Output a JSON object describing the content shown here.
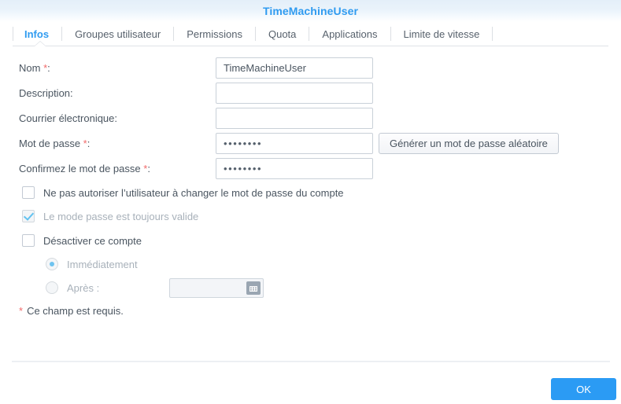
{
  "window": {
    "title": "TimeMachineUser",
    "title_color": "#2f9bf0"
  },
  "tabs": [
    {
      "label": "Infos",
      "active": true
    },
    {
      "label": "Groupes utilisateur",
      "active": false
    },
    {
      "label": "Permissions",
      "active": false
    },
    {
      "label": "Quota",
      "active": false
    },
    {
      "label": "Applications",
      "active": false
    },
    {
      "label": "Limite de vitesse",
      "active": false
    }
  ],
  "form": {
    "name": {
      "label": "Nom",
      "required_mark": "*",
      "colon": ":",
      "value": "TimeMachineUser",
      "placeholder": ""
    },
    "description": {
      "label": "Description:",
      "value": "",
      "placeholder": ""
    },
    "email": {
      "label": "Courrier électronique:",
      "value": "",
      "placeholder": ""
    },
    "password": {
      "label": "Mot de passe",
      "required_mark": "*",
      "colon": ":",
      "value": "••••••••",
      "generate_button": "Générer un mot de passe aléatoire"
    },
    "confirm_password": {
      "label": "Confirmez le mot de passe",
      "required_mark": "*",
      "colon": ":",
      "value": "••••••••"
    },
    "checkboxes": [
      {
        "label": "Ne pas autoriser l’utilisateur à changer le mot de passe du compte",
        "checked": false,
        "disabled": false
      },
      {
        "label": "Le mode passe est toujours valide",
        "checked": true,
        "disabled": true
      },
      {
        "label": "Désactiver ce compte",
        "checked": false,
        "disabled": false
      }
    ],
    "disable_options": [
      {
        "label": "Immédiatement",
        "selected": true,
        "disabled": true
      },
      {
        "label": "Après :",
        "selected": false,
        "disabled": true
      }
    ],
    "date_field": {
      "value": "",
      "placeholder": "",
      "icon": "calendar-icon",
      "disabled": true
    },
    "required_note": {
      "mark": "*",
      "text": "Ce champ est requis."
    }
  },
  "footer": {
    "ok_label": "OK",
    "ok_color": "#2b9bf4"
  }
}
